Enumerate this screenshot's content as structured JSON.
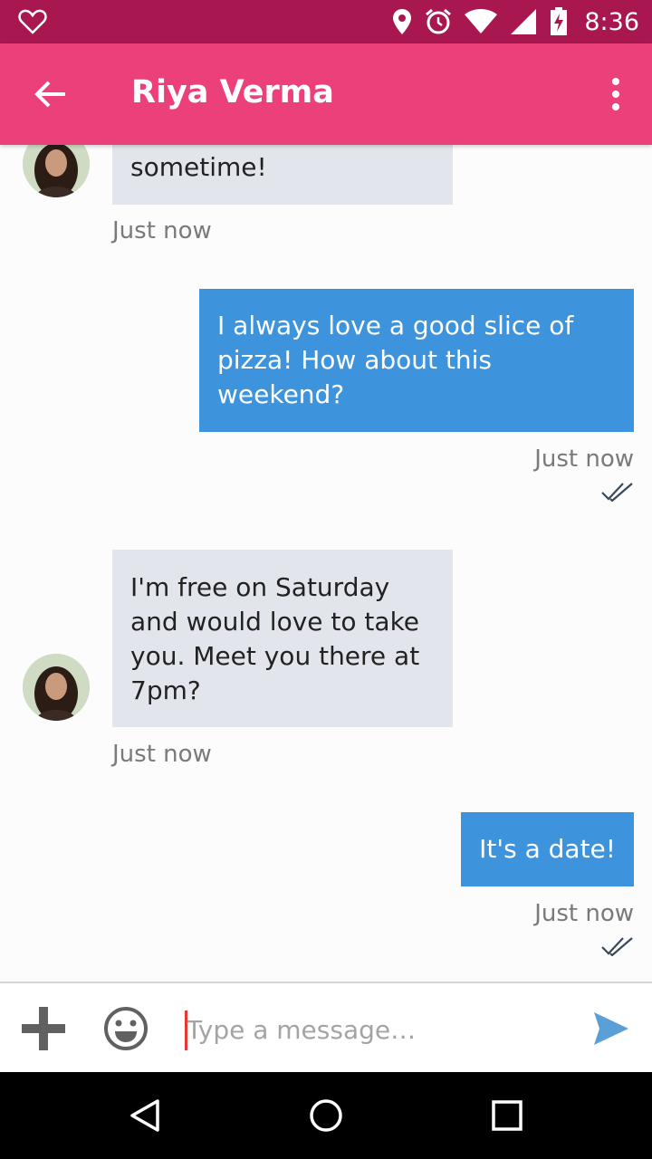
{
  "status_bar": {
    "time": "8:36",
    "left_icon": "heart-outline-icon",
    "icons": [
      "location-icon",
      "alarm-icon",
      "wifi-icon",
      "signal-icon",
      "battery-charging-icon"
    ]
  },
  "app_bar": {
    "title": "Riya Verma",
    "back_icon": "arrow-back-icon",
    "menu_icon": "more-vert-icon",
    "color": "#ec407a"
  },
  "messages": [
    {
      "direction": "incoming",
      "text": "sometime!",
      "time": "Just now"
    },
    {
      "direction": "outgoing",
      "text": "I always love a good slice of pizza! How about this weekend?",
      "time": "Just now",
      "status": "read"
    },
    {
      "direction": "incoming",
      "text": "I'm free on Saturday and would love to take you. Meet you there at 7pm?",
      "time": "Just now"
    },
    {
      "direction": "outgoing",
      "text": "It's a date!",
      "time": "Just now",
      "status": "read"
    }
  ],
  "composer": {
    "placeholder": "Type a message…",
    "value": "",
    "attach_icon": "plus-icon",
    "emoji_icon": "emoji-icon",
    "send_icon": "send-icon"
  },
  "nav_bar": {
    "icons": [
      "back-triangle-icon",
      "home-circle-icon",
      "recents-square-icon"
    ]
  },
  "colors": {
    "status_bar": "#a8174f",
    "incoming_bubble": "#e2e6ec",
    "outgoing_bubble": "#3d93dc"
  }
}
